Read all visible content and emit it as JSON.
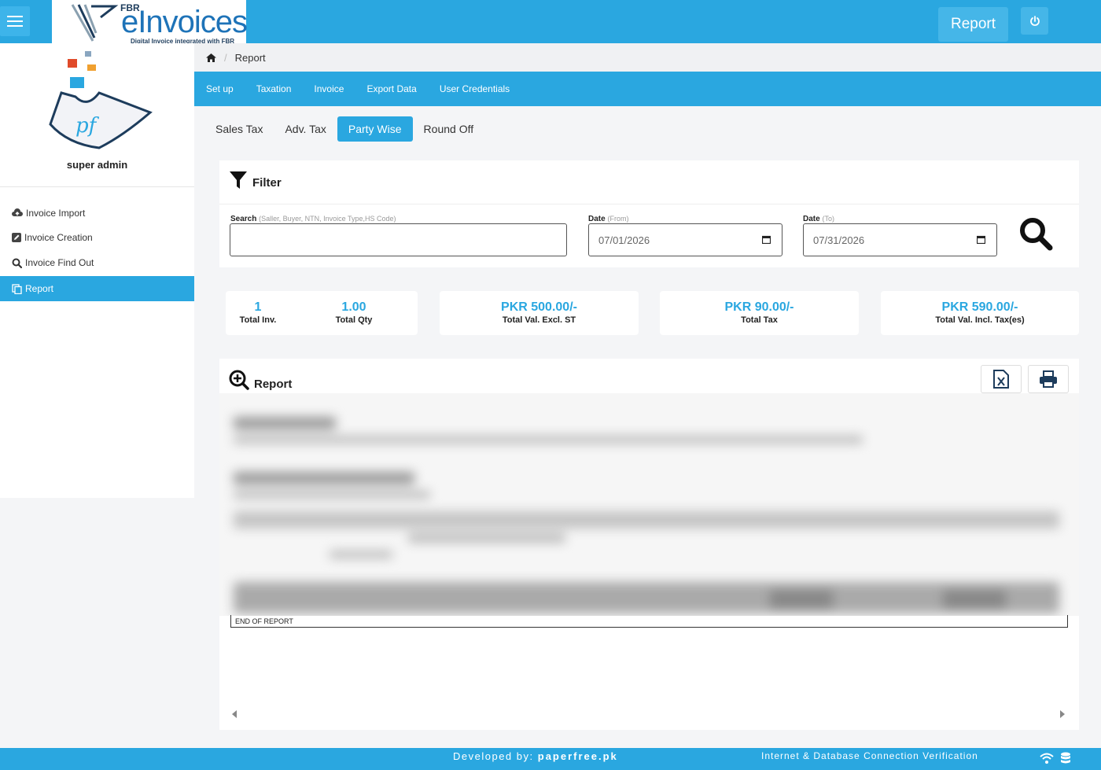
{
  "header": {
    "logo_fbr": "FBR",
    "logo_main": "eInvoices",
    "logo_tagline": "Digital Invoice integrated with FBR",
    "report_button": "Report",
    "menu_icon": "hamburger-menu-icon",
    "power_icon": "power-icon"
  },
  "sidebar": {
    "user_name": "super admin",
    "items": [
      {
        "label": "Invoice Import",
        "icon": "cloud-upload-icon"
      },
      {
        "label": "Invoice Creation",
        "icon": "edit-icon"
      },
      {
        "label": "Invoice Find Out",
        "icon": "search-icon"
      },
      {
        "label": "Report",
        "icon": "copy-icon",
        "active": true
      }
    ]
  },
  "breadcrumb": {
    "home_icon": "home-icon",
    "current": "Report"
  },
  "menu": {
    "items": [
      "Set up",
      "Taxation",
      "Invoice",
      "Export Data",
      "User Credentials"
    ]
  },
  "tabs": {
    "items": [
      "Sales Tax",
      "Adv. Tax",
      "Party Wise",
      "Round Off"
    ],
    "active": "Party Wise"
  },
  "filter": {
    "title": "Filter",
    "search_label": "Search",
    "search_hint": "(Saller, Buyer, NTN, Invoice Type,HS Code)",
    "search_value": "",
    "date_label": "Date",
    "date_from_hint": "(From)",
    "date_from_value": "07/01/2026",
    "date_to_hint": "(To)",
    "date_to_value": "07/31/2026"
  },
  "stats": {
    "total_inv_value": "1",
    "total_inv_label": "Total Inv.",
    "total_qty_value": "1.00",
    "total_qty_label": "Total Qty",
    "excl_value": "PKR 500.00/-",
    "excl_label": "Total Val. Excl. ST",
    "tax_value": "PKR 90.00/-",
    "tax_label": "Total Tax",
    "incl_value": "PKR 590.00/-",
    "incl_label": "Total Val. Incl. Tax(es)"
  },
  "report": {
    "title": "Report",
    "end_text": "END OF REPORT",
    "export_icon": "file-excel-icon",
    "print_icon": "print-icon"
  },
  "footer": {
    "developed_by": "Developed by:",
    "developer": "paperfree.pk",
    "connection_text": "Internet & Database Connection Verification",
    "wifi_icon": "wifi-icon",
    "database_icon": "database-icon"
  },
  "colors": {
    "accent": "#2aa7e0",
    "sidebar_active": "#2aa7e0"
  }
}
